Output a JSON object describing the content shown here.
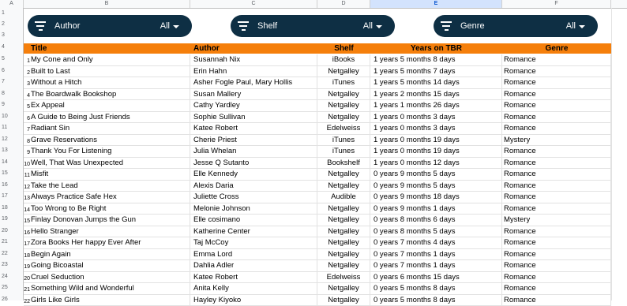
{
  "col_headers": [
    "A",
    "B",
    "C",
    "D",
    "E",
    "F"
  ],
  "row_numbers": [
    "1",
    "2",
    "3",
    "4",
    "5",
    "6",
    "7",
    "8",
    "9",
    "10",
    "11",
    "12",
    "13",
    "14",
    "15",
    "16",
    "17",
    "18",
    "19",
    "20",
    "21",
    "22",
    "23",
    "24",
    "25",
    "26"
  ],
  "filters": [
    {
      "name": "Author",
      "value": "All"
    },
    {
      "name": "Shelf",
      "value": "All"
    },
    {
      "name": "Genre",
      "value": "All"
    }
  ],
  "table": {
    "headers": [
      "Title",
      "Author",
      "Shelf",
      "Years on TBR",
      "Genre"
    ],
    "rows": [
      {
        "n": "1",
        "title": "My Cone and Only",
        "author": "Susannah Nix",
        "shelf": "iBooks",
        "tbr": "1 years 5 months 8 days",
        "genre": "Romance"
      },
      {
        "n": "2",
        "title": "Built to Last",
        "author": "Erin Hahn",
        "shelf": "Netgalley",
        "tbr": "1 years 5 months 7 days",
        "genre": "Romance"
      },
      {
        "n": "3",
        "title": "Without a Hitch",
        "author": "Asher Fogle Paul, Mary Hollis",
        "shelf": "iTunes",
        "tbr": "1 years 5 months 14 days",
        "genre": "Romance"
      },
      {
        "n": "4",
        "title": "The Boardwalk Bookshop",
        "author": "Susan Mallery",
        "shelf": "Netgalley",
        "tbr": "1 years 2 months 15 days",
        "genre": "Romance"
      },
      {
        "n": "5",
        "title": "Ex Appeal",
        "author": "Cathy Yardley",
        "shelf": "Netgalley",
        "tbr": "1 years 1 months 26 days",
        "genre": "Romance"
      },
      {
        "n": "6",
        "title": "A Guide to Being Just Friends",
        "author": "Sophie Sullivan",
        "shelf": "Netgalley",
        "tbr": "1 years 0 months 3 days",
        "genre": "Romance"
      },
      {
        "n": "7",
        "title": "Radiant Sin",
        "author": "Katee Robert",
        "shelf": "Edelweiss",
        "tbr": "1 years 0 months 3 days",
        "genre": "Romance"
      },
      {
        "n": "8",
        "title": "Grave Reservations",
        "author": "Cherie Priest",
        "shelf": "iTunes",
        "tbr": "1 years 0 months 19 days",
        "genre": "Mystery"
      },
      {
        "n": "9",
        "title": "Thank You For Listening",
        "author": "Julia Whelan",
        "shelf": "iTunes",
        "tbr": "1 years 0 months 19 days",
        "genre": "Romance"
      },
      {
        "n": "10",
        "title": "Well, That Was Unexpected",
        "author": "Jesse Q Sutanto",
        "shelf": "Bookshelf",
        "tbr": "1 years 0 months 12 days",
        "genre": "Romance"
      },
      {
        "n": "11",
        "title": "Misfit",
        "author": "Elle Kennedy",
        "shelf": "Netgalley",
        "tbr": "0 years 9 months 5 days",
        "genre": "Romance"
      },
      {
        "n": "12",
        "title": "Take the Lead",
        "author": "Alexis Daria",
        "shelf": "Netgalley",
        "tbr": "0 years 9 months 5 days",
        "genre": "Romance"
      },
      {
        "n": "13",
        "title": "Always Practice Safe Hex",
        "author": "Juliette Cross",
        "shelf": "Audible",
        "tbr": "0 years 9 months 18 days",
        "genre": "Romance"
      },
      {
        "n": "14",
        "title": "Too Wrong to Be Right",
        "author": "Melonie Johnson",
        "shelf": "Netgalley",
        "tbr": "0 years 9 months 1 days",
        "genre": "Romance"
      },
      {
        "n": "15",
        "title": "Finlay Donovan Jumps the Gun",
        "author": "Elle cosimano",
        "shelf": "Netgalley",
        "tbr": "0 years 8 months 6 days",
        "genre": "Mystery"
      },
      {
        "n": "16",
        "title": "Hello Stranger",
        "author": "Katherine Center",
        "shelf": "Netgalley",
        "tbr": "0 years 8 months 5 days",
        "genre": "Romance"
      },
      {
        "n": "17",
        "title": "Zora Books Her happy Ever After",
        "author": "Taj McCoy",
        "shelf": "Netgalley",
        "tbr": "0 years 7 months 4 days",
        "genre": "Romance"
      },
      {
        "n": "18",
        "title": "Begin Again",
        "author": "Emma Lord",
        "shelf": "Netgalley",
        "tbr": "0 years 7 months 1 days",
        "genre": "Romance"
      },
      {
        "n": "19",
        "title": "Going Bicoastal",
        "author": "Dahlia Adler",
        "shelf": "Netgalley",
        "tbr": "0 years 7 months 1 days",
        "genre": "Romance"
      },
      {
        "n": "20",
        "title": "Cruel Seduction",
        "author": "Katee Robert",
        "shelf": "Edelweiss",
        "tbr": "0 years 6 months 15 days",
        "genre": "Romance"
      },
      {
        "n": "21",
        "title": "Something Wild and Wonderful",
        "author": "Anita Kelly",
        "shelf": "Netgalley",
        "tbr": "0 years 5 months 8 days",
        "genre": "Romance"
      },
      {
        "n": "22",
        "title": "Girls Like Girls",
        "author": "Hayley Kiyoko",
        "shelf": "Netgalley",
        "tbr": "0 years 5 months 8 days",
        "genre": "Romance"
      }
    ]
  }
}
